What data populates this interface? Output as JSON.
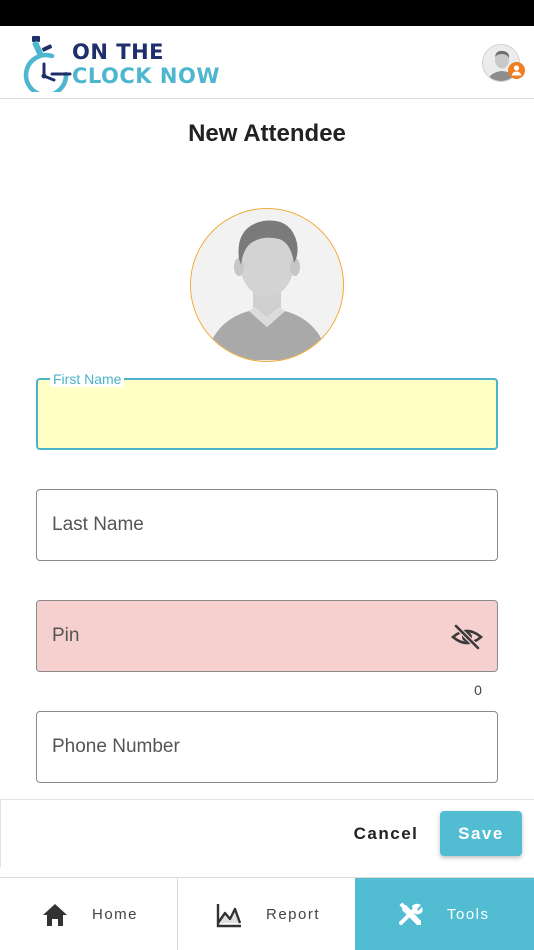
{
  "header": {
    "logo_line1": "ON THE",
    "logo_line2": "CLOCK NOW"
  },
  "page": {
    "title": "New Attendee"
  },
  "form": {
    "first_name": {
      "label": "First Name",
      "value": ""
    },
    "last_name": {
      "placeholder": "Last Name",
      "value": ""
    },
    "pin": {
      "placeholder": "Pin",
      "value": "",
      "char_count": "0"
    },
    "phone": {
      "placeholder": "Phone Number",
      "value": ""
    }
  },
  "actions": {
    "cancel_label": "Cancel",
    "save_label": "Save"
  },
  "nav": {
    "items": [
      {
        "label": "Home",
        "icon": "home-icon",
        "active": false
      },
      {
        "label": "Report",
        "icon": "chart-icon",
        "active": false
      },
      {
        "label": "Tools",
        "icon": "tools-icon",
        "active": true
      }
    ]
  },
  "colors": {
    "accent": "#52bdd2",
    "focused_field_bg": "#ffffc6",
    "error_field_bg": "#f6cfcf",
    "photo_ring": "#f0a830",
    "badge": "#ef7d22",
    "brand_dark": "#1f2f6b"
  }
}
